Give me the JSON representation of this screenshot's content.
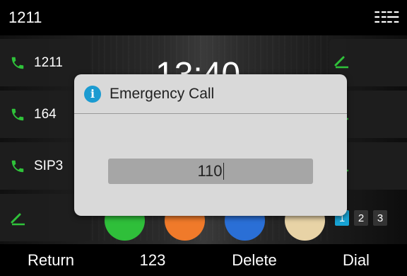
{
  "status_bar": {
    "title": "1211",
    "network_icon": "network-icon"
  },
  "line_keys": [
    {
      "label": "1211",
      "icon": "phone-icon"
    },
    {
      "label": "164",
      "icon": "phone-icon"
    },
    {
      "label": "SIP3",
      "icon": "phone-icon"
    },
    {
      "label": "",
      "icon": "edit-icon"
    }
  ],
  "right_keys": [
    {
      "icon": "edit-icon"
    },
    {
      "icon": "edit-icon"
    },
    {
      "icon": "edit-icon"
    }
  ],
  "background_clock": "13:40",
  "dialog": {
    "title": "Emergency Call",
    "icon": "info-icon",
    "number": "110"
  },
  "pages": {
    "items": [
      "1",
      "2",
      "3"
    ],
    "active": "1"
  },
  "softkeys": [
    "Return",
    "123",
    "Delete",
    "Dial"
  ],
  "colors": {
    "accent": "#17a3d4",
    "phone_green": "#2fc23a",
    "dialog_bg": "#d9d9d9"
  }
}
